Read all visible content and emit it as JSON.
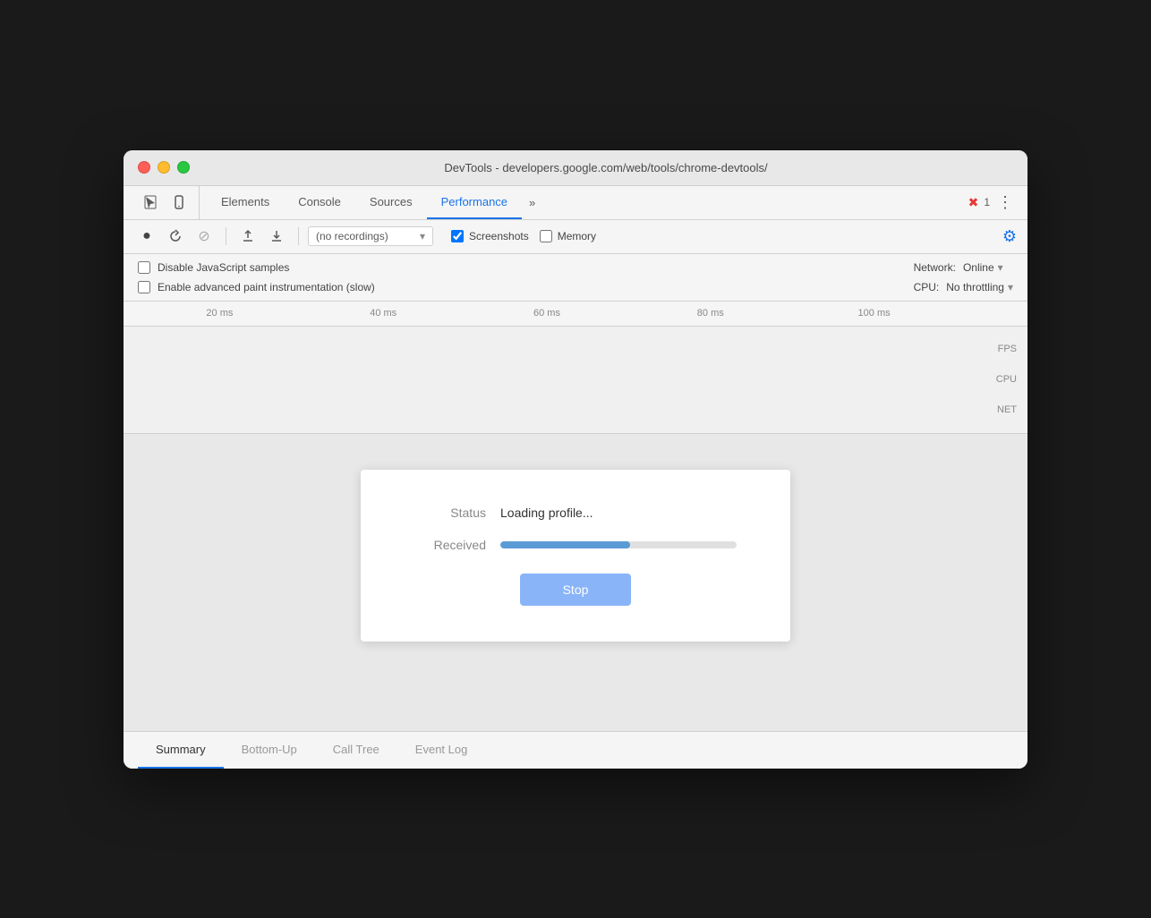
{
  "window": {
    "title": "DevTools - developers.google.com/web/tools/chrome-devtools/"
  },
  "tabs": {
    "items": [
      "Elements",
      "Console",
      "Sources",
      "Performance"
    ],
    "active": "Performance",
    "more_label": "»",
    "error_count": "1"
  },
  "toolbar": {
    "record_label": "●",
    "reload_label": "↺",
    "clear_label": "⊘",
    "upload_label": "↑",
    "download_label": "↓",
    "recordings_placeholder": "(no recordings)",
    "screenshots_label": "Screenshots",
    "memory_label": "Memory"
  },
  "options": {
    "disable_js_samples": "Disable JavaScript samples",
    "enable_paint": "Enable advanced paint instrumentation (slow)",
    "network_label": "Network:",
    "network_value": "Online",
    "cpu_label": "CPU:",
    "cpu_value": "No throttling"
  },
  "timeline": {
    "marks": [
      "20 ms",
      "40 ms",
      "60 ms",
      "80 ms",
      "100 ms"
    ],
    "labels": [
      "FPS",
      "CPU",
      "NET"
    ]
  },
  "loading": {
    "status_label": "Status",
    "status_value": "Loading profile...",
    "received_label": "Received",
    "progress_percent": 55,
    "stop_label": "Stop"
  },
  "bottom_tabs": {
    "items": [
      "Summary",
      "Bottom-Up",
      "Call Tree",
      "Event Log"
    ],
    "active": "Summary"
  },
  "icons": {
    "cursor": "↖",
    "mobile": "⊡",
    "chevron_down": "▾",
    "gear": "⚙",
    "more_vert": "⋮"
  }
}
